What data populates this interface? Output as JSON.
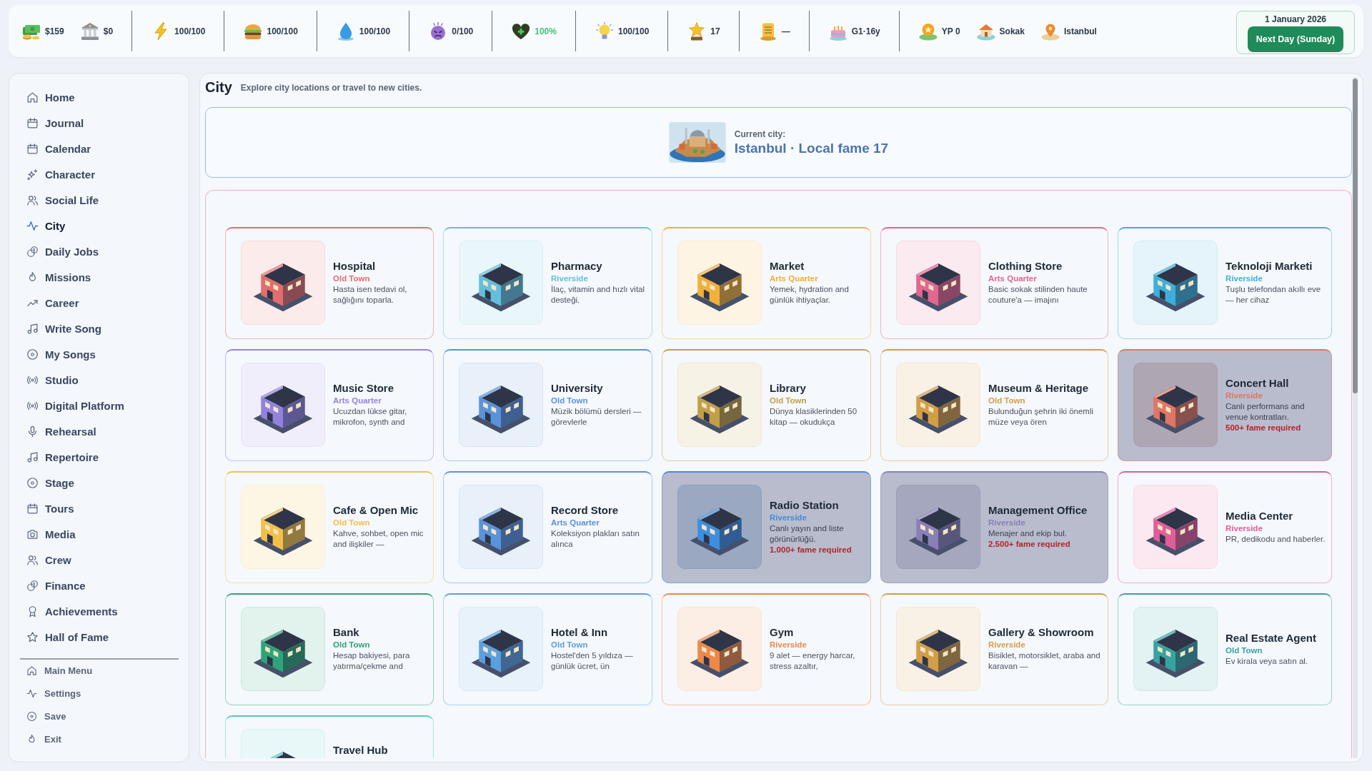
{
  "top_bar": {
    "sections": [
      {
        "items": [
          {
            "value": "$159",
            "highlighted": false
          },
          {
            "value": "$0",
            "highlighted": false
          }
        ]
      },
      {
        "items": [
          {
            "value": "100/100",
            "highlighted": false
          }
        ]
      },
      {
        "items": [
          {
            "value": "100/100",
            "highlighted": false
          }
        ]
      },
      {
        "items": [
          {
            "value": "100/100",
            "highlighted": false
          }
        ]
      },
      {
        "items": [
          {
            "value": "0/100",
            "highlighted": false
          }
        ]
      },
      {
        "items": [
          {
            "value": "100%",
            "highlighted": true
          }
        ]
      },
      {
        "items": [
          {
            "value": "100/100",
            "highlighted": false
          }
        ]
      },
      {
        "items": [
          {
            "value": "17",
            "highlighted": false
          }
        ]
      },
      {
        "items": [
          {
            "value": "—",
            "highlighted": false
          }
        ]
      },
      {
        "items": [
          {
            "value": "G1·16y",
            "highlighted": false
          }
        ]
      },
      {
        "items": [
          {
            "value": "YP 0",
            "highlighted": false
          },
          {
            "value": "Sokak",
            "highlighted": false
          },
          {
            "value": "Istanbul",
            "highlighted": false
          }
        ]
      }
    ],
    "date": "1 January 2026",
    "next_day_button": "Next Day (Sunday)"
  },
  "sidebar": {
    "items": [
      {
        "label": "Home",
        "selected": false
      },
      {
        "label": "Journal",
        "selected": false
      },
      {
        "label": "Calendar",
        "selected": false
      },
      {
        "label": "Character",
        "selected": false
      },
      {
        "label": "Social Life",
        "selected": false
      },
      {
        "label": "City",
        "selected": true
      },
      {
        "label": "Daily Jobs",
        "selected": false
      },
      {
        "label": "Missions",
        "selected": false
      },
      {
        "label": "Career",
        "selected": false
      },
      {
        "label": "Write Song",
        "selected": false
      },
      {
        "label": "My Songs",
        "selected": false
      },
      {
        "label": "Studio",
        "selected": false
      },
      {
        "label": "Digital Platform",
        "selected": false
      },
      {
        "label": "Rehearsal",
        "selected": false
      },
      {
        "label": "Repertoire",
        "selected": false
      },
      {
        "label": "Stage",
        "selected": false
      },
      {
        "label": "Tours",
        "selected": false
      },
      {
        "label": "Media",
        "selected": false
      },
      {
        "label": "Crew",
        "selected": false
      },
      {
        "label": "Finance",
        "selected": false
      },
      {
        "label": "Achievements",
        "selected": false
      },
      {
        "label": "Hall of Fame",
        "selected": false
      }
    ],
    "footer_items": [
      {
        "label": "Main Menu"
      },
      {
        "label": "Settings"
      },
      {
        "label": "Save"
      },
      {
        "label": "Exit"
      }
    ]
  },
  "page": {
    "title": "City",
    "subtitle": "Explore city locations or travel to new cities."
  },
  "current_city": {
    "caption": "Current city:",
    "value": "Istanbul · Local fame 17"
  },
  "locations": {
    "cards": [
      {
        "name": "Hospital",
        "district": "Old Town",
        "description": "Hasta isen tedavi ol, sağlığını toparla.",
        "color": "#e26d6d",
        "locked": false,
        "clipped": false
      },
      {
        "name": "Pharmacy",
        "district": "Riverside",
        "description": "İlaç, vitamin and hızlı vital desteği.",
        "color": "#63bfdc",
        "locked": false,
        "clipped": false
      },
      {
        "name": "Market",
        "district": "Arts Quarter",
        "description": "Yemek, hydration and günlük ihtiyaçlar.",
        "color": "#f0b03a",
        "locked": false,
        "clipped": false
      },
      {
        "name": "Clothing Store",
        "district": "Arts Quarter",
        "description": "Basic sokak stilinden haute couture'a — imajını",
        "color": "#e2668f",
        "locked": false,
        "clipped": false
      },
      {
        "name": "Teknoloji Marketi",
        "district": "Riverside",
        "description": "Tuşlu telefondan akıllı eve — her cihaz",
        "color": "#3eafdb",
        "locked": false,
        "clipped": false
      },
      {
        "name": "Music Store",
        "district": "Arts Quarter",
        "description": "Ucuzdan lükse gitar, mikrofon, synth and",
        "color": "#9282e0",
        "locked": false,
        "clipped": false
      },
      {
        "name": "University",
        "district": "Old Town",
        "description": "Müzik bölümü dersleri — görevlerle",
        "color": "#5a92dc",
        "locked": false,
        "clipped": false
      },
      {
        "name": "Library",
        "district": "Old Town",
        "description": "Dünya klasiklerinden 50 kitap — okudukça",
        "color": "#c0a048",
        "locked": false,
        "clipped": false
      },
      {
        "name": "Museum & Heritage",
        "district": "Old Town",
        "description": "Bulunduğun şehrin iki önemli müze veya ören",
        "color": "#d29e48",
        "locked": false,
        "clipped": false
      },
      {
        "name": "Concert Hall",
        "district": "Riverside",
        "description": "Canlı performans and venue kontratları.",
        "requirement": "500+ fame required",
        "color": "#e07664",
        "locked": true,
        "clipped": false
      },
      {
        "name": "Cafe & Open Mic",
        "district": "Old Town",
        "description": "Kahve, sohbet, open mic and ilişkiler —",
        "color": "#f1c048",
        "locked": false,
        "clipped": false
      },
      {
        "name": "Record Store",
        "district": "Arts Quarter",
        "description": "Koleksiyon plakları satın alınca",
        "color": "#5a92dc",
        "locked": false,
        "clipped": false
      },
      {
        "name": "Radio Station",
        "district": "Riverside",
        "description": "Canlı yayın and liste görünürlüğü.",
        "requirement": "1.000+ fame required",
        "color": "#3e8ee0",
        "locked": true,
        "clipped": false
      },
      {
        "name": "Management Office",
        "district": "Riverside",
        "description": "Menajer and ekip bul.",
        "requirement": "2.500+ fame required",
        "color": "#8a80b8",
        "locked": true,
        "clipped": false
      },
      {
        "name": "Media Center",
        "district": "Riverside",
        "description": "PR, dedikodu and haberler.",
        "color": "#e05e98",
        "locked": false,
        "clipped": false
      },
      {
        "name": "Bank",
        "district": "Old Town",
        "description": "Hesap bakiyesi, para yatırma/çekme and",
        "color": "#2ea478",
        "locked": false,
        "clipped": false
      },
      {
        "name": "Hotel & Inn",
        "district": "Old Town",
        "description": "Hostel'den 5 yıldıza — günlük ücret, ün",
        "color": "#5a9fe0",
        "locked": false,
        "clipped": false
      },
      {
        "name": "Gym",
        "district": "Riverside",
        "description": "9 alet — energy harcar, stress azaltır,",
        "color": "#ee8848",
        "locked": false,
        "clipped": false
      },
      {
        "name": "Gallery & Showroom",
        "district": "Riverside",
        "description": "Bisiklet, motorsiklet, araba and karavan —",
        "color": "#d29e48",
        "locked": false,
        "clipped": false
      },
      {
        "name": "Real Estate Agent",
        "district": "Old Town",
        "description": "Ev kirala veya satın al.",
        "color": "#38a2a0",
        "locked": false,
        "clipped": false
      },
      {
        "name": "Travel Hub",
        "color": "#58c6cc",
        "locked": false,
        "clipped": true
      }
    ]
  }
}
